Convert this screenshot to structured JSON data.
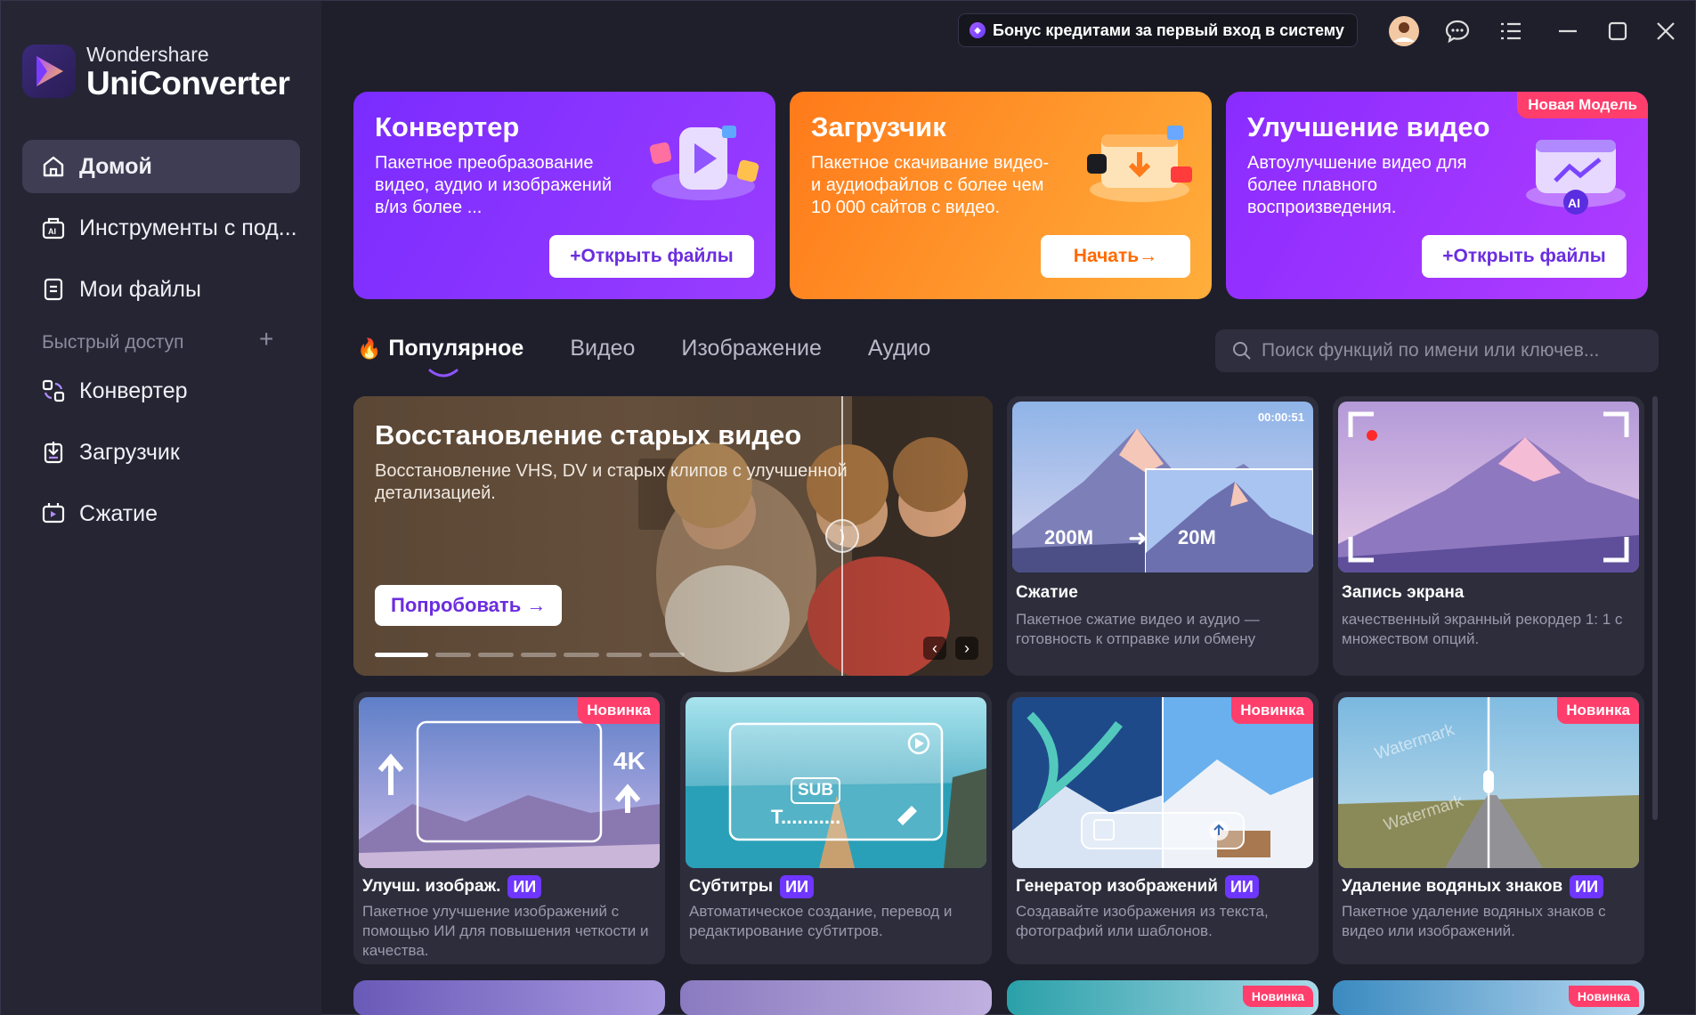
{
  "colors": {
    "accent": "#6e36ff",
    "new_badge": "#ff3e6c",
    "sidebar_bg": "#252534",
    "main_bg": "#1f1f2c"
  },
  "logo": {
    "brand": "Wondershare",
    "product": "UniConverter"
  },
  "sidebar": {
    "items": [
      {
        "label": "Домой",
        "icon": "home-icon"
      },
      {
        "label": "Инструменты с под...",
        "icon": "ai-tools-icon"
      },
      {
        "label": "Мои файлы",
        "icon": "files-icon"
      }
    ],
    "quick_access_label": "Быстрый доступ",
    "quick_access_add": "+",
    "quick_items": [
      {
        "label": "Конвертер",
        "icon": "converter-icon"
      },
      {
        "label": "Загрузчик",
        "icon": "downloader-icon"
      },
      {
        "label": "Сжатие",
        "icon": "compress-icon"
      }
    ]
  },
  "topbar": {
    "bonus_text": "Бонус кредитами за первый вход в систему"
  },
  "hero_cards": [
    {
      "title": "Конвертер",
      "desc": "Пакетное преобразование видео, аудио и изображений в/из более ...",
      "button": "+Открыть файлы",
      "badge": ""
    },
    {
      "title": "Загрузчик",
      "desc": "Пакетное скачивание видео- и аудиофайлов с более чем 10 000 сайтов с видео.",
      "button": "Начать→",
      "badge": ""
    },
    {
      "title": "Улучшение видео",
      "desc": "Автоулучшение видео для более плавного воспроизведения.",
      "button": "+Открыть файлы",
      "badge": "Новая Модель"
    }
  ],
  "tabs": [
    {
      "label": "Популярное"
    },
    {
      "label": "Видео"
    },
    {
      "label": "Изображение"
    },
    {
      "label": "Аудио"
    }
  ],
  "search": {
    "placeholder": "Поиск функций по имени или ключев..."
  },
  "banner": {
    "title": "Восстановление старых видео",
    "desc": "Восстановление VHS, DV и старых клипов с улучшенной детализацией.",
    "button": "Попробовать →",
    "dots_total": 7,
    "dots_active": 1
  },
  "cards": [
    {
      "title": "Сжатие",
      "desc": "Пакетное сжатие видео и аудио — готовность к отправке или обмену",
      "ai": "",
      "badge": "",
      "thumb": {
        "timestamp": "00:00:51",
        "from": "200M",
        "to": "20M"
      }
    },
    {
      "title": "Запись экрана",
      "desc": "качественный экранный рекордер 1: 1 с множеством опций.",
      "ai": "",
      "badge": ""
    },
    {
      "title": "Улучш. изображ.",
      "desc": "Пакетное улучшение изображений с помощью ИИ для повышения четкости и качества.",
      "ai": "ИИ",
      "badge": "Новинка",
      "thumb": {
        "label": "4K"
      }
    },
    {
      "title": "Субтитры",
      "desc": "Автоматическое создание, перевод и редактирование субтитров.",
      "ai": "ИИ",
      "badge": "",
      "thumb": {
        "sub": "SUB",
        "text": "T..........."
      }
    },
    {
      "title": "Генератор изображений",
      "desc": "Создавайте изображения из текста, фотографий или шаблонов.",
      "ai": "ИИ",
      "badge": "Новинка"
    },
    {
      "title": "Удаление водяных знаков",
      "desc": "Пакетное удаление водяных знаков с видео или изображений.",
      "ai": "ИИ",
      "badge": "Новинка",
      "thumb": {
        "watermark": "Watermark"
      }
    }
  ],
  "bottom_badges": [
    "Новинка",
    "Новинка"
  ]
}
